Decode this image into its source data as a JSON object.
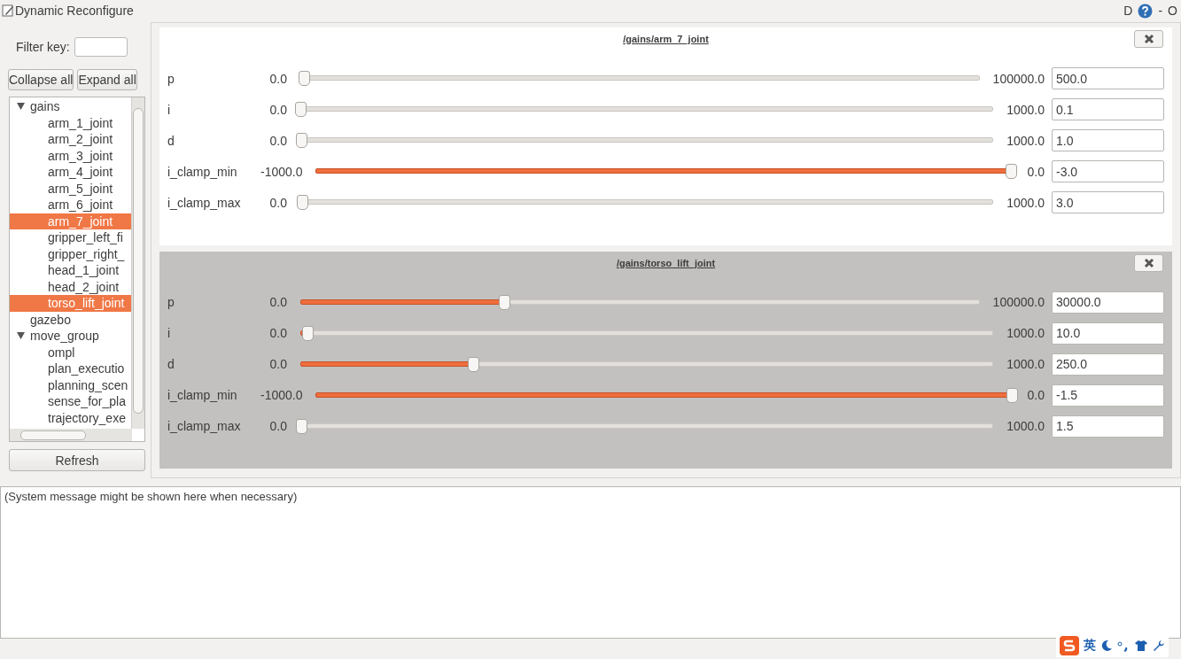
{
  "window": {
    "title": "Dynamic Reconfigure"
  },
  "title_controls": [
    {
      "kind": "text",
      "label": "D"
    },
    {
      "kind": "help"
    },
    {
      "kind": "text",
      "label": "-"
    },
    {
      "kind": "text",
      "label": "O"
    }
  ],
  "filter": {
    "label": "Filter key:"
  },
  "buttons": [
    "Collapse all",
    "Expand all"
  ],
  "tree": [
    {
      "label": "gains",
      "expanded": true,
      "selected": false,
      "children": [
        {
          "label": "arm_1_joint",
          "selected": false
        },
        {
          "label": "arm_2_joint",
          "selected": false
        },
        {
          "label": "arm_3_joint",
          "selected": false
        },
        {
          "label": "arm_4_joint",
          "selected": false
        },
        {
          "label": "arm_5_joint",
          "selected": false
        },
        {
          "label": "arm_6_joint",
          "selected": false
        },
        {
          "label": "arm_7_joint",
          "selected": true
        },
        {
          "label": "gripper_left_fi",
          "selected": false
        },
        {
          "label": "gripper_right_",
          "selected": false
        },
        {
          "label": "head_1_joint",
          "selected": false
        },
        {
          "label": "head_2_joint",
          "selected": false
        },
        {
          "label": "torso_lift_joint",
          "selected": true
        }
      ]
    },
    {
      "label": "gazebo",
      "selected": false
    },
    {
      "label": "move_group",
      "expanded": true,
      "selected": false,
      "children": [
        {
          "label": "ompl",
          "selected": false
        },
        {
          "label": "plan_executio",
          "selected": false
        },
        {
          "label": "planning_scen",
          "selected": false
        },
        {
          "label": "sense_for_pla",
          "selected": false
        },
        {
          "label": "trajectory_exe",
          "selected": false
        }
      ]
    }
  ],
  "refresh_button": "Refresh",
  "groups": [
    {
      "title": "/gains/arm_7_joint",
      "highlighted": false,
      "params": [
        {
          "name": "p",
          "min": "0.0",
          "max": "100000.0",
          "level": 0.005,
          "value": "500.0"
        },
        {
          "name": "i",
          "min": "0.0",
          "max": "1000.0",
          "level": 0.0001,
          "value": "0.1"
        },
        {
          "name": "d",
          "min": "0.0",
          "max": "1000.0",
          "level": 0.001,
          "value": "1.0"
        },
        {
          "name": "i_clamp_min",
          "min": "-1000.0",
          "max": "0.0",
          "level": 0.997,
          "value": "-3.0"
        },
        {
          "name": "i_clamp_max",
          "min": "0.0",
          "max": "1000.0",
          "level": 0.003,
          "value": "3.0"
        }
      ]
    },
    {
      "title": "/gains/torso_lift_joint",
      "highlighted": true,
      "params": [
        {
          "name": "p",
          "min": "0.0",
          "max": "100000.0",
          "level": 0.3,
          "value": "30000.0"
        },
        {
          "name": "i",
          "min": "0.0",
          "max": "1000.0",
          "level": 0.01,
          "value": "10.0"
        },
        {
          "name": "d",
          "min": "0.0",
          "max": "1000.0",
          "level": 0.25,
          "value": "250.0"
        },
        {
          "name": "i_clamp_min",
          "min": "-1000.0",
          "max": "0.0",
          "level": 0.9985,
          "value": "-1.5"
        },
        {
          "name": "i_clamp_max",
          "min": "0.0",
          "max": "1000.0",
          "level": 0.0015,
          "value": "1.5"
        }
      ]
    }
  ],
  "message": "(System message might be shown here when necessary)",
  "ime": {
    "label": "英"
  }
}
